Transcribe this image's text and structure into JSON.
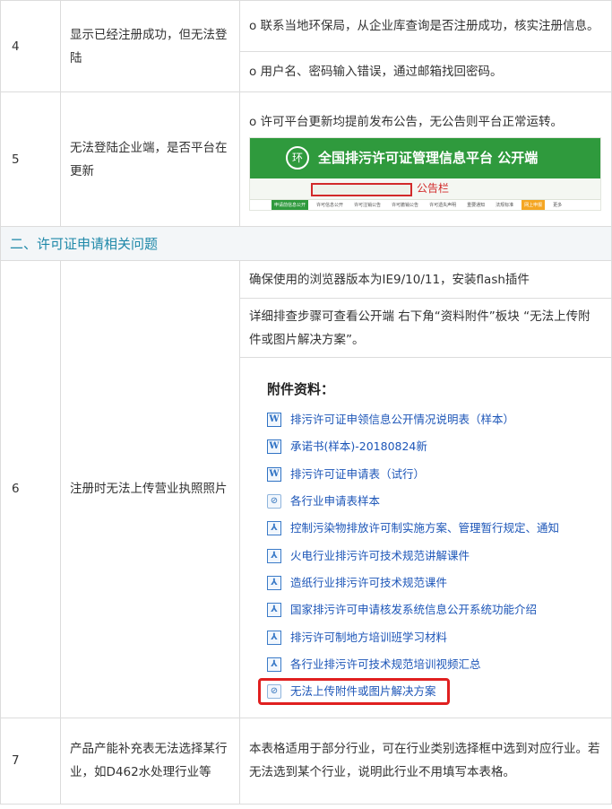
{
  "rows": [
    {
      "num": "4",
      "question": "显示已经注册成功，但无法登陆",
      "answers": [
        "o 联系当地环保局，从企业库查询是否注册成功，核实注册信息。",
        "o 用户名、密码输入错误，通过邮箱找回密码。"
      ]
    },
    {
      "num": "5",
      "question": "无法登陆企业端，是否平台在更新",
      "answer": "o 许可平台更新均提前发布公告，无公告则平台正常运转。",
      "banner": {
        "emblem": "环",
        "title": "全国排污许可证管理信息平台 公开端",
        "notice_label": "公告栏",
        "nav": [
          "申请前信息公开",
          "许可信息公开",
          "许可注销公告",
          "许可撤销公告",
          "许可遗失声明",
          "重要通知",
          "法规标准",
          "网上申报",
          "更多"
        ]
      }
    }
  ],
  "section2": {
    "title": "二、许可证申请相关问题"
  },
  "row6": {
    "num": "6",
    "question": "注册时无法上传营业执照照片",
    "answers": [
      "确保使用的浏览器版本为IE9/10/11，安装flash插件",
      "详细排查步骤可查看公开端 右下角“资料附件”板块 “无法上传附件或图片解决方案”。"
    ],
    "attachments": {
      "title": "附件资料：",
      "items": [
        {
          "label": "排污许可证申领信息公开情况说明表（样本）",
          "icon": "word-icon",
          "glyph": "W"
        },
        {
          "label": "承诺书(样本)-20180824新",
          "icon": "word-icon",
          "glyph": "W"
        },
        {
          "label": "排污许可证申请表（试行）",
          "icon": "word-icon",
          "glyph": "W"
        },
        {
          "label": "各行业申请表样本",
          "icon": "link-icon",
          "glyph": "⊘"
        },
        {
          "label": "控制污染物排放许可制实施方案、管理暂行规定、通知",
          "icon": "pdf-icon",
          "glyph": "⅄"
        },
        {
          "label": "火电行业排污许可技术规范讲解课件",
          "icon": "pdf-icon",
          "glyph": "⅄"
        },
        {
          "label": "造纸行业排污许可技术规范课件",
          "icon": "pdf-icon",
          "glyph": "⅄"
        },
        {
          "label": "国家排污许可申请核发系统信息公开系统功能介绍",
          "icon": "pdf-icon",
          "glyph": "⅄"
        },
        {
          "label": "排污许可制地方培训班学习材料",
          "icon": "pdf-icon",
          "glyph": "⅄"
        },
        {
          "label": "各行业排污许可技术规范培训视频汇总",
          "icon": "pdf-icon",
          "glyph": "⅄"
        },
        {
          "label": "无法上传附件或图片解决方案",
          "icon": "link-icon",
          "glyph": "⊘"
        }
      ]
    }
  },
  "row7": {
    "num": "7",
    "question": "产品产能补充表无法选择某行业，如D462水处理行业等",
    "answer": "本表格适用于部分行业，可在行业类别选择框中选到对应行业。若无法选到某个行业，说明此行业不用填写本表格。"
  },
  "colors": {
    "section_text": "#1e88a8",
    "link": "#1d56b8",
    "highlight": "#e02020",
    "banner_green": "#2f9a3d"
  }
}
